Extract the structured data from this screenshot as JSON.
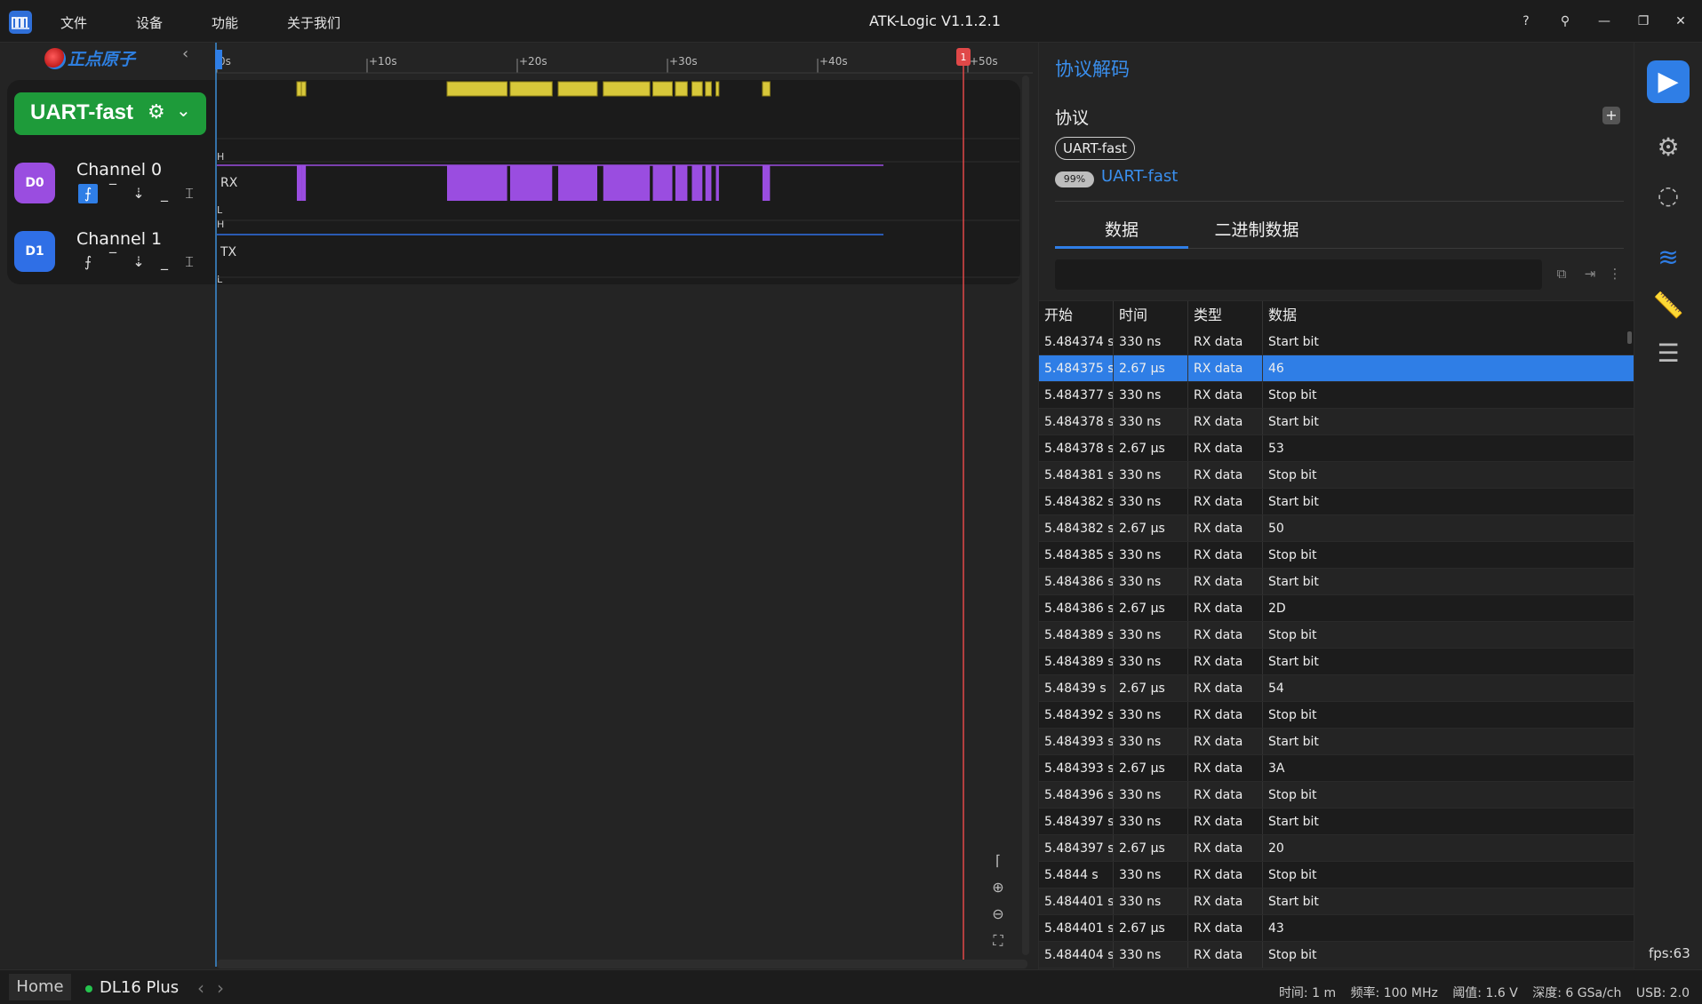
{
  "app": {
    "title": "ATK-Logic V1.1.2.1",
    "menu": [
      "文件",
      "设备",
      "功能",
      "关于我们"
    ],
    "window_buttons": [
      "?",
      "⚲",
      "—",
      "❐",
      "✕"
    ]
  },
  "left": {
    "brand": "正点原子",
    "decoder_label": "UART-fast",
    "channels": [
      {
        "badge": "D0",
        "name": "Channel 0",
        "color": "#9a4de0",
        "signal": "RX"
      },
      {
        "badge": "D1",
        "name": "Channel 1",
        "color": "#2f6fe6",
        "signal": "TX"
      }
    ],
    "level_high": "H",
    "level_low": "L"
  },
  "timeline": {
    "ticks": [
      "0s",
      "+10s",
      "+20s",
      "+30s",
      "+40s",
      "+50s"
    ],
    "marker_label": "1",
    "rx_bursts": [
      [
        0,
        0.3
      ],
      [
        0.3,
        0.6
      ],
      [
        10,
        14
      ],
      [
        14.2,
        17
      ],
      [
        17.4,
        20
      ],
      [
        20.4,
        23.5
      ],
      [
        23.7,
        25
      ],
      [
        25.2,
        26
      ],
      [
        26.3,
        27
      ],
      [
        27.2,
        27.6
      ],
      [
        27.9,
        28.1
      ],
      [
        31,
        31.5
      ]
    ]
  },
  "decode": {
    "title": "协议解码",
    "protocol_label": "协议",
    "protocol_tag": "UART-fast",
    "progress": "99%",
    "protocol_name": "UART-fast",
    "tabs": [
      "数据",
      "二进制数据"
    ],
    "search_placeholder": "",
    "columns": [
      "开始",
      "时间",
      "类型",
      "数据"
    ],
    "rows": [
      [
        "5.484374 s",
        "330 ns",
        "RX data",
        "Start bit"
      ],
      [
        "5.484375 s",
        "2.67 µs",
        "RX data",
        "46"
      ],
      [
        "5.484377 s",
        "330 ns",
        "RX data",
        "Stop bit"
      ],
      [
        "5.484378 s",
        "330 ns",
        "RX data",
        "Start bit"
      ],
      [
        "5.484378 s",
        "2.67 µs",
        "RX data",
        "53"
      ],
      [
        "5.484381 s",
        "330 ns",
        "RX data",
        "Stop bit"
      ],
      [
        "5.484382 s",
        "330 ns",
        "RX data",
        "Start bit"
      ],
      [
        "5.484382 s",
        "2.67 µs",
        "RX data",
        "50"
      ],
      [
        "5.484385 s",
        "330 ns",
        "RX data",
        "Stop bit"
      ],
      [
        "5.484386 s",
        "330 ns",
        "RX data",
        "Start bit"
      ],
      [
        "5.484386 s",
        "2.67 µs",
        "RX data",
        "2D"
      ],
      [
        "5.484389 s",
        "330 ns",
        "RX data",
        "Stop bit"
      ],
      [
        "5.484389 s",
        "330 ns",
        "RX data",
        "Start bit"
      ],
      [
        "5.48439 s",
        "2.67 µs",
        "RX data",
        "54"
      ],
      [
        "5.484392 s",
        "330 ns",
        "RX data",
        "Stop bit"
      ],
      [
        "5.484393 s",
        "330 ns",
        "RX data",
        "Start bit"
      ],
      [
        "5.484393 s",
        "2.67 µs",
        "RX data",
        "3A"
      ],
      [
        "5.484396 s",
        "330 ns",
        "RX data",
        "Stop bit"
      ],
      [
        "5.484397 s",
        "330 ns",
        "RX data",
        "Start bit"
      ],
      [
        "5.484397 s",
        "2.67 µs",
        "RX data",
        "20"
      ],
      [
        "5.4844 s",
        "330 ns",
        "RX data",
        "Stop bit"
      ],
      [
        "5.484401 s",
        "330 ns",
        "RX data",
        "Start bit"
      ],
      [
        "5.484401 s",
        "2.67 µs",
        "RX data",
        "43"
      ],
      [
        "5.484404 s",
        "330 ns",
        "RX data",
        "Stop bit"
      ]
    ],
    "selected_row": 1
  },
  "right_bar": {
    "fps": "fps:63"
  },
  "status": {
    "home": "Home",
    "device": "DL16 Plus",
    "info": [
      "时间: 1 m",
      "频率: 100 MHz",
      "阈值: 1.6 V",
      "深度: 6 GSa/ch",
      "USB: 2.0"
    ]
  },
  "colors": {
    "accent": "#2f7ee6",
    "rx_wave": "#9a4de0",
    "tx_wave": "#2f6fe6",
    "decode_fill": "#d8c83a",
    "marker": "#e04848"
  }
}
